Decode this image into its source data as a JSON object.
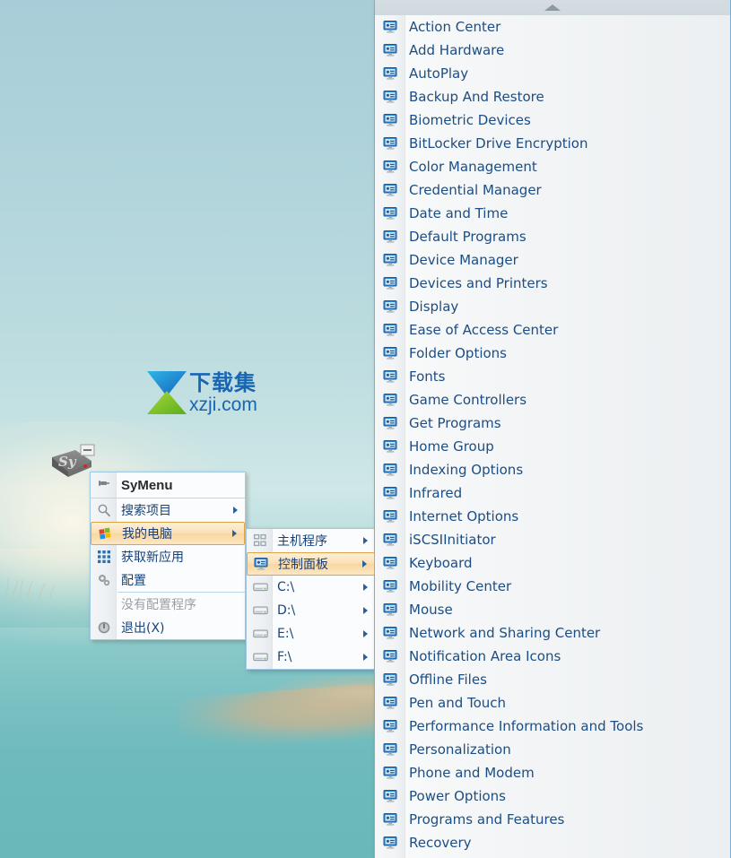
{
  "desktop": {
    "icon_label": "SyMenu",
    "icon_name": "symenu-drive-icon",
    "watermark": {
      "cn": "下载集",
      "domain": "xzji.com"
    }
  },
  "main_menu": {
    "title": "SyMenu",
    "title_icon": "pin-icon",
    "items": [
      {
        "label": "搜索项目",
        "icon": "magnifier-icon",
        "arrow": true,
        "highlighted": false,
        "disabled": false
      },
      {
        "label": "我的电脑",
        "icon": "windows-flag-icon",
        "arrow": true,
        "highlighted": true,
        "disabled": false
      },
      {
        "label": "获取新应用",
        "icon": "apps-grid-icon",
        "arrow": false,
        "highlighted": false,
        "disabled": false
      },
      {
        "label": "配置",
        "icon": "gears-icon",
        "arrow": false,
        "highlighted": false,
        "disabled": false
      },
      {
        "label": "没有配置程序",
        "icon": "",
        "arrow": false,
        "highlighted": false,
        "disabled": true
      },
      {
        "label": "退出(X)",
        "icon": "power-icon",
        "arrow": false,
        "highlighted": false,
        "disabled": false
      }
    ]
  },
  "sub_menu": {
    "items": [
      {
        "label": "主机程序",
        "icon": "four-squares-icon",
        "arrow": true,
        "highlighted": false
      },
      {
        "label": "控制面板",
        "icon": "control-panel-icon",
        "arrow": true,
        "highlighted": true
      },
      {
        "label": "C:\\",
        "icon": "drive-icon",
        "arrow": true,
        "highlighted": false
      },
      {
        "label": "D:\\",
        "icon": "drive-icon",
        "arrow": true,
        "highlighted": false
      },
      {
        "label": "E:\\",
        "icon": "drive-icon",
        "arrow": true,
        "highlighted": false
      },
      {
        "label": "F:\\",
        "icon": "drive-icon",
        "arrow": true,
        "highlighted": false
      }
    ]
  },
  "control_panel": {
    "scroll_up_icon": "scroll-up-arrow-icon",
    "items": [
      "Action Center",
      "Add Hardware",
      "AutoPlay",
      "Backup And Restore",
      "Biometric Devices",
      "BitLocker Drive Encryption",
      "Color Management",
      "Credential Manager",
      "Date and Time",
      "Default Programs",
      "Device Manager",
      "Devices and Printers",
      "Display",
      "Ease of Access Center",
      "Folder Options",
      "Fonts",
      "Game Controllers",
      "Get Programs",
      "Home Group",
      "Indexing Options",
      "Infrared",
      "Internet Options",
      "iSCSIInitiator",
      "Keyboard",
      "Mobility Center",
      "Mouse",
      "Network and Sharing Center",
      "Notification Area Icons",
      "Offline Files",
      "Pen and Touch",
      "Performance Information and Tools",
      "Personalization",
      "Phone and Modem",
      "Power Options",
      "Programs and Features",
      "Recovery"
    ]
  },
  "colors": {
    "highlight_border": "#e0a343",
    "menu_border": "#9ec8e8",
    "link_text": "#1c4d84",
    "menu_text": "#16427a",
    "disabled_text": "#9aa0a6"
  }
}
